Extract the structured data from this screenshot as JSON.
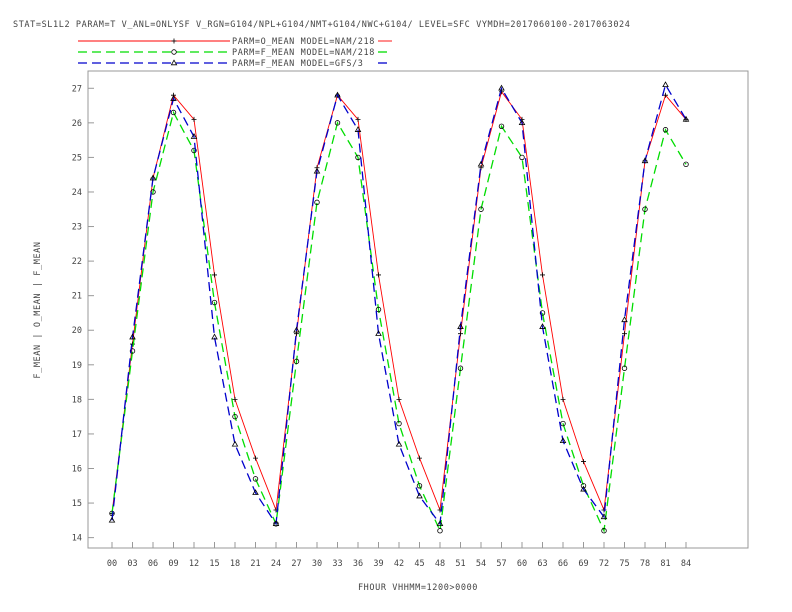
{
  "header": {
    "title": "STAT=SL1L2 PARAM=T V_ANL=ONLYSF V_RGN=G104/NPL+G104/NMT+G104/NWC+G104/ LEVEL=SFC VYMDH=2017060100-2017063024"
  },
  "chart_data": {
    "type": "line",
    "title": "STAT=SL1L2 PARAM=T V_ANL=ONLYSF V_RGN=G104/NPL+G104/NMT+G104/NWC+G104/ LEVEL=SFC VYMDH=2017060100-2017063024",
    "xlabel": "FHOUR VHHMM=1200>0000",
    "ylabel": "F_MEAN | O_MEAN | F_MEAN",
    "categories": [
      "00",
      "03",
      "06",
      "09",
      "12",
      "15",
      "18",
      "21",
      "24",
      "27",
      "30",
      "33",
      "36",
      "39",
      "42",
      "45",
      "48",
      "51",
      "54",
      "57",
      "60",
      "63",
      "66",
      "69",
      "72",
      "75",
      "78",
      "81",
      "84"
    ],
    "ylim": [
      13.7,
      27.5
    ],
    "yticks": [
      14,
      15,
      16,
      17,
      18,
      19,
      20,
      21,
      22,
      23,
      24,
      25,
      26,
      27
    ],
    "grid": false,
    "legend_position": "top-left",
    "series": [
      {
        "name": "PARM=O_MEAN MODEL=NAM/218",
        "color": "#ff0000",
        "dash": "solid",
        "marker": "plus",
        "values": [
          14.7,
          19.6,
          24.4,
          26.8,
          26.1,
          21.6,
          18.0,
          16.3,
          14.8,
          19.9,
          24.7,
          26.8,
          26.1,
          21.6,
          18.0,
          16.3,
          14.8,
          19.9,
          24.7,
          26.9,
          26.1,
          21.6,
          18.0,
          16.2,
          14.8,
          19.9,
          24.9,
          26.8,
          26.1
        ]
      },
      {
        "name": "PARM=F_MEAN MODEL=NAM/218",
        "color": "#00dd00",
        "dash": "long",
        "marker": "circle",
        "values": [
          14.7,
          19.4,
          24.0,
          26.3,
          25.2,
          20.8,
          17.5,
          15.7,
          14.4,
          19.1,
          23.7,
          26.0,
          25.0,
          20.6,
          17.3,
          15.5,
          14.2,
          18.9,
          23.5,
          25.9,
          25.0,
          20.5,
          17.3,
          15.5,
          14.2,
          18.9,
          23.5,
          25.8,
          24.8
        ]
      },
      {
        "name": "PARM=F_MEAN MODEL=GFS/3",
        "color": "#0000cc",
        "dash": "long",
        "marker": "triangle",
        "values": [
          14.5,
          19.8,
          24.4,
          26.7,
          25.6,
          19.8,
          16.7,
          15.3,
          14.4,
          20.0,
          24.6,
          26.8,
          25.8,
          19.9,
          16.7,
          15.2,
          14.4,
          20.1,
          24.8,
          27.0,
          26.0,
          20.1,
          16.8,
          15.4,
          14.6,
          20.3,
          24.9,
          27.1,
          26.1
        ]
      }
    ]
  }
}
